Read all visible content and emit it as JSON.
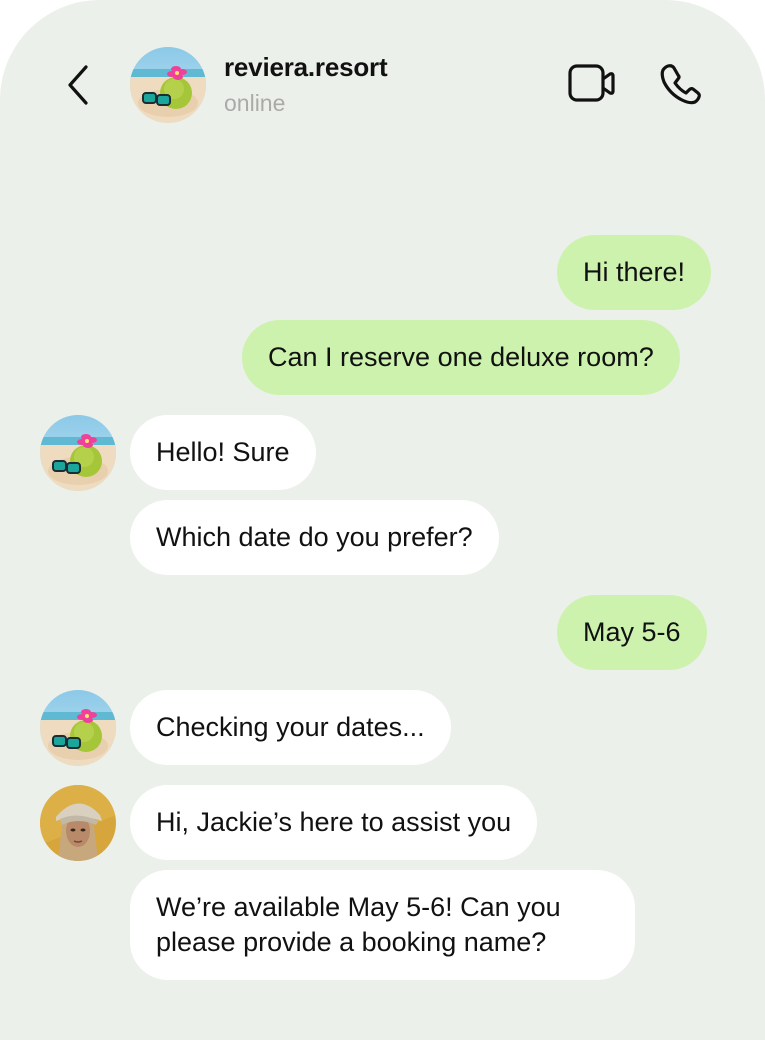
{
  "header": {
    "title": "reviera.resort",
    "status": "online",
    "back_icon": "chevron-left-icon",
    "video_icon": "video-camera-icon",
    "call_icon": "phone-icon"
  },
  "colors": {
    "background": "#ecf0ea",
    "outgoing_bubble": "#cdf2ae",
    "incoming_bubble": "#ffffff",
    "status_text": "#a9aba8"
  },
  "messages": [
    {
      "direction": "outgoing",
      "text": "Hi there!"
    },
    {
      "direction": "outgoing",
      "text": "Can I reserve one deluxe room?"
    },
    {
      "direction": "incoming",
      "sender": "reviera.resort",
      "avatar": "resort-avatar",
      "text": "Hello! Sure"
    },
    {
      "direction": "incoming",
      "sender": "reviera.resort",
      "text": "Which date do you prefer?"
    },
    {
      "direction": "outgoing",
      "text": "May 5-6"
    },
    {
      "direction": "incoming",
      "sender": "reviera.resort",
      "avatar": "resort-avatar",
      "text": "Checking your dates..."
    },
    {
      "direction": "incoming",
      "sender": "Jackie",
      "avatar": "agent-avatar",
      "text": "Hi, Jackie’s here to assist you"
    },
    {
      "direction": "incoming",
      "sender": "Jackie",
      "text": "We’re available May 5-6! Can you please provide a booking name?"
    }
  ]
}
